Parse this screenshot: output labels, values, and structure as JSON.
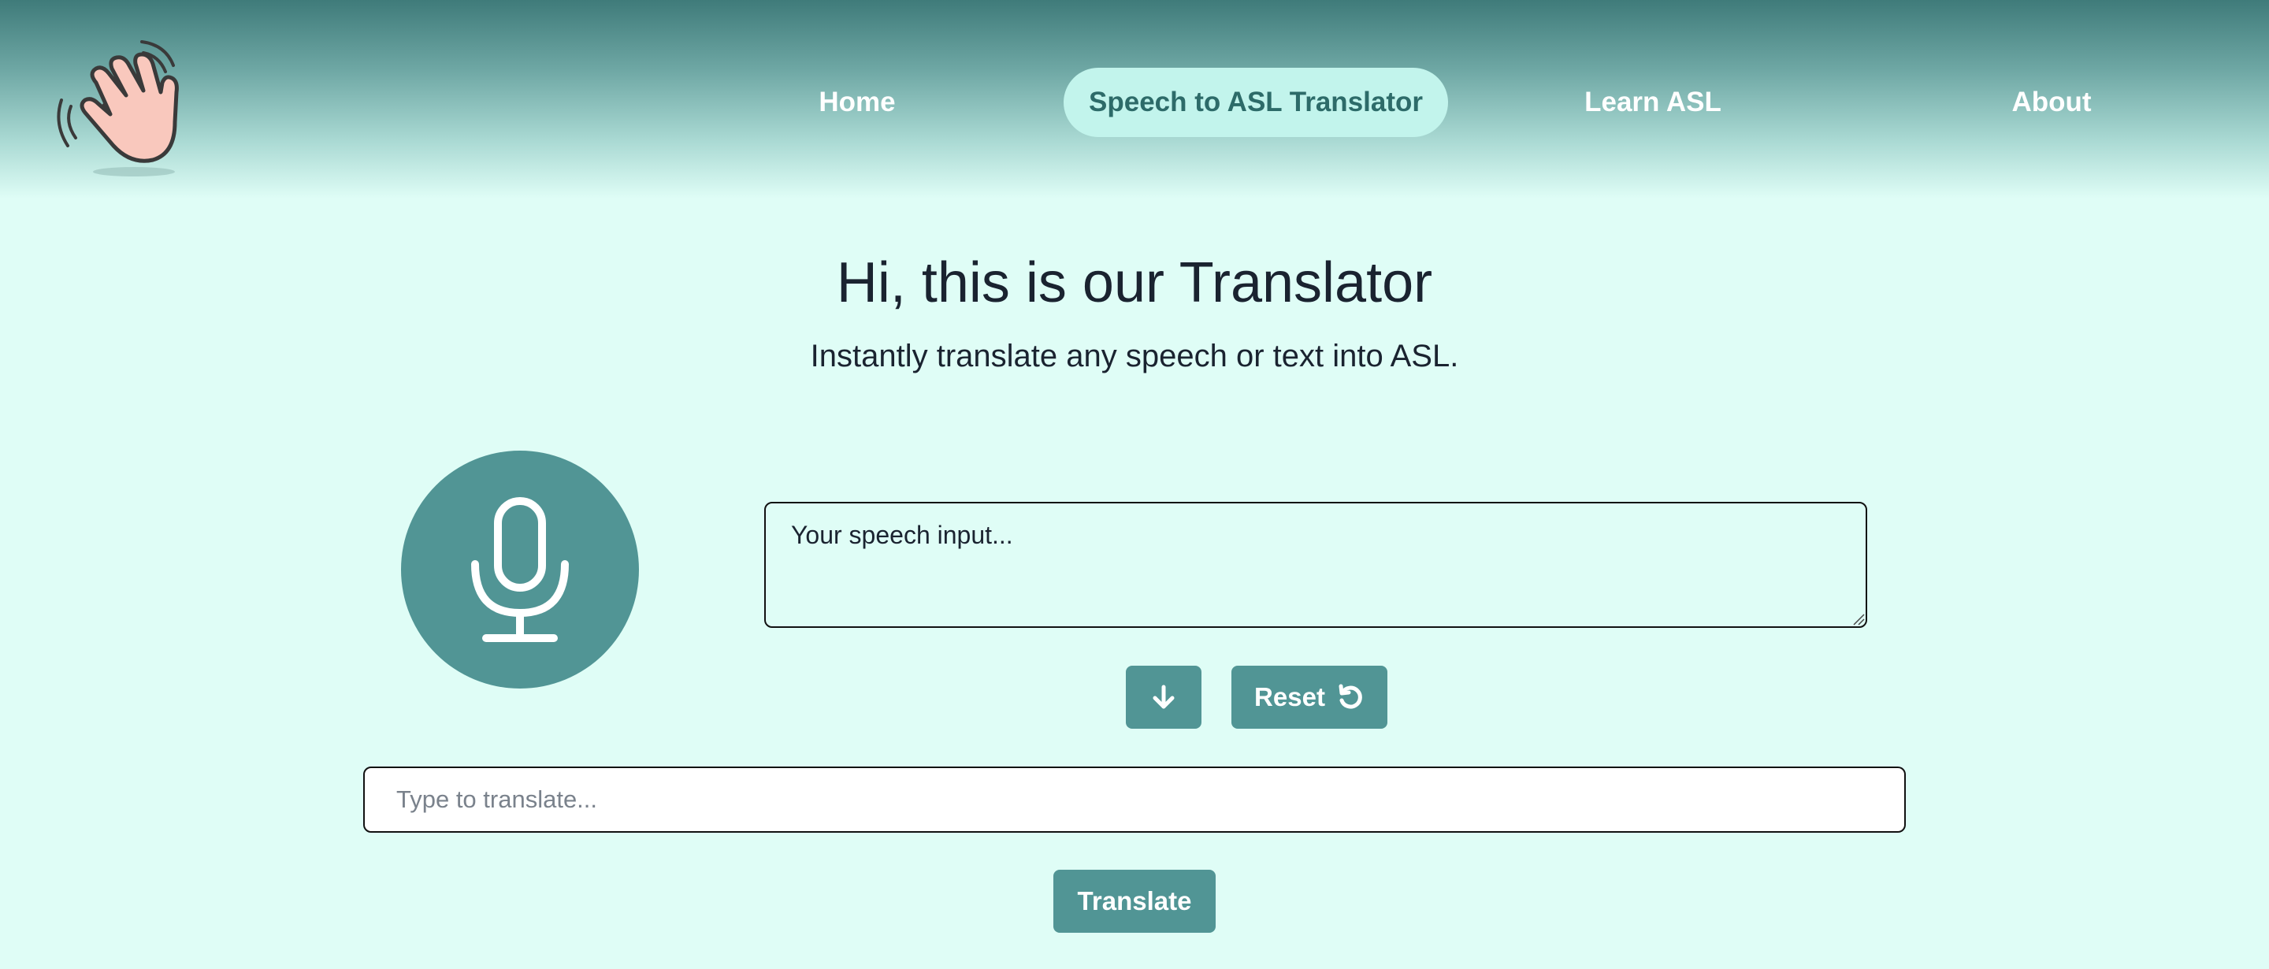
{
  "nav": {
    "home": "Home",
    "translator": "Speech to ASL Translator",
    "learn": "Learn ASL",
    "about": "About"
  },
  "main": {
    "title": "Hi, this is our Translator",
    "subtitle": "Instantly translate any speech or text into ASL."
  },
  "speech": {
    "placeholder": "Your speech input..."
  },
  "buttons": {
    "reset": "Reset",
    "translate": "Translate"
  },
  "text_input": {
    "placeholder": "Type to translate..."
  },
  "icons": {
    "logo": "waving-hand-icon",
    "mic": "microphone-icon",
    "down": "arrow-down-icon",
    "reset": "rotate-ccw-icon"
  },
  "colors": {
    "background": "#dffdf6",
    "accent": "#519595",
    "nav_active": "#c2f4ec",
    "nav_top": "#3f7b7a"
  }
}
